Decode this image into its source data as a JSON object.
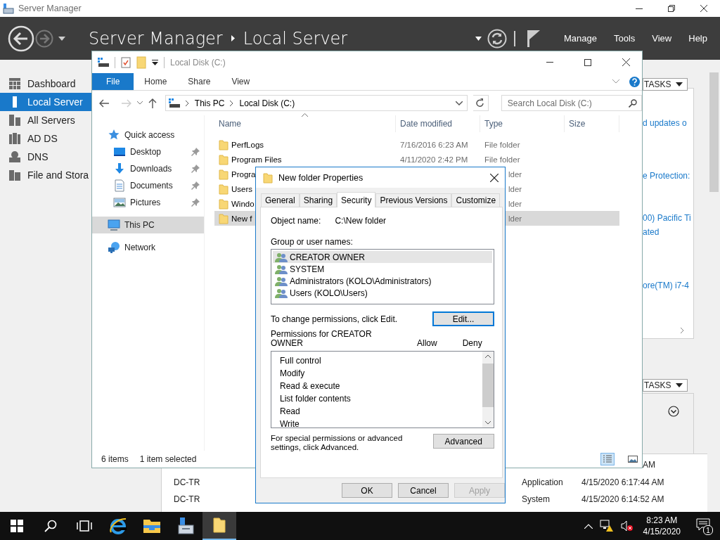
{
  "server_manager": {
    "title": "Server Manager",
    "breadcrumb": [
      "Server Manager",
      "Local Server"
    ],
    "menu": [
      "Manage",
      "Tools",
      "View",
      "Help"
    ],
    "nav": [
      {
        "label": "Dashboard",
        "kind": "dashboard",
        "selected": false
      },
      {
        "label": "Local Server",
        "kind": "server",
        "selected": true
      },
      {
        "label": "All Servers",
        "kind": "servers",
        "selected": false
      },
      {
        "label": "AD DS",
        "kind": "adds",
        "selected": false
      },
      {
        "label": "DNS",
        "kind": "dns",
        "selected": false
      },
      {
        "label": "File and Stora",
        "kind": "storage",
        "selected": false
      }
    ],
    "tasks_buttons": [
      "TASKS",
      "TASKS"
    ],
    "fragments": [
      "d updates o",
      "e Protection:",
      "00) Pacific Ti",
      "ated",
      "ore(TM) i7-4"
    ],
    "event_fragment": "AM",
    "events": [
      {
        "server": "DC-TR",
        "log": "Application",
        "date": "4/15/2020 6:17:44 AM"
      },
      {
        "server": "DC-TR",
        "log": "System",
        "date": "4/15/2020 6:14:52 AM"
      }
    ]
  },
  "explorer": {
    "title": "Local Disk (C:)",
    "ribbon_tabs": [
      {
        "label": "File",
        "selected": true
      },
      {
        "label": "Home",
        "selected": false
      },
      {
        "label": "Share",
        "selected": false
      },
      {
        "label": "View",
        "selected": false
      }
    ],
    "path": [
      "This PC",
      "Local Disk (C:)"
    ],
    "search": {
      "placeholder": "Search Local Disk (C:)"
    },
    "nav": [
      {
        "label": "Quick access",
        "kind": "star",
        "pinned": false,
        "selected": false,
        "children": [
          {
            "label": "Desktop",
            "kind": "desktop",
            "pinned": true,
            "selected": false
          },
          {
            "label": "Downloads",
            "kind": "download",
            "pinned": true,
            "selected": false
          },
          {
            "label": "Documents",
            "kind": "document",
            "pinned": true,
            "selected": false
          },
          {
            "label": "Pictures",
            "kind": "picture",
            "pinned": true,
            "selected": false
          }
        ]
      },
      {
        "label": "This PC",
        "kind": "pc",
        "pinned": false,
        "selected": true
      },
      {
        "label": "Network",
        "kind": "network",
        "pinned": false,
        "selected": false
      }
    ],
    "columns": [
      "Name",
      "Date modified",
      "Type",
      "Size"
    ],
    "files": [
      {
        "name": "PerfLogs",
        "date": "7/16/2016 6:23 AM",
        "type": "File folder",
        "selected": false
      },
      {
        "name": "Program Files",
        "date": "4/11/2020 2:42 PM",
        "type": "File folder",
        "selected": false
      },
      {
        "name": "Progra",
        "type": "lder",
        "selected": false
      },
      {
        "name": "Users",
        "type": "lder",
        "selected": false
      },
      {
        "name": "Windo",
        "type": "lder",
        "selected": false
      },
      {
        "name": "New f",
        "type": "lder",
        "selected": true
      }
    ],
    "status": [
      "6 items",
      "1 item selected"
    ]
  },
  "dialog": {
    "title": "New folder Properties",
    "tabs": [
      {
        "label": "General",
        "selected": false
      },
      {
        "label": "Sharing",
        "selected": false
      },
      {
        "label": "Security",
        "selected": true
      },
      {
        "label": "Previous Versions",
        "selected": false
      },
      {
        "label": "Customize",
        "selected": false
      }
    ],
    "object_label": "Object name:",
    "object_value": "C:\\New folder",
    "groups_label": "Group or user names:",
    "groups": [
      {
        "name": "CREATOR OWNER",
        "selected": true
      },
      {
        "name": "SYSTEM",
        "selected": false
      },
      {
        "name": "Administrators (KOLO\\Administrators)",
        "selected": false
      },
      {
        "name": "Users (KOLO\\Users)",
        "selected": false
      }
    ],
    "change_hint": "To change permissions, click Edit.",
    "edit_button": "Edit...",
    "permissions_label": "Permissions for CREATOR OWNER",
    "allow": "Allow",
    "deny": "Deny",
    "permissions": [
      "Full control",
      "Modify",
      "Read & execute",
      "List folder contents",
      "Read",
      "Write"
    ],
    "advanced_hint": "For special permissions or advanced settings, click Advanced.",
    "advanced_button": "Advanced",
    "buttons": [
      {
        "label": "OK",
        "disabled": false
      },
      {
        "label": "Cancel",
        "disabled": false
      },
      {
        "label": "Apply",
        "disabled": true
      }
    ]
  },
  "taskbar": {
    "apps": [
      {
        "kind": "start",
        "active": false
      },
      {
        "kind": "search",
        "active": false
      },
      {
        "kind": "taskview",
        "active": false
      },
      {
        "kind": "ie",
        "active": false
      },
      {
        "kind": "explorer",
        "active": false
      },
      {
        "kind": "server-manager",
        "active": false
      },
      {
        "kind": "folder",
        "active": true
      }
    ],
    "time": "8:23 AM",
    "date": "4/15/2020",
    "notifications": "1"
  }
}
